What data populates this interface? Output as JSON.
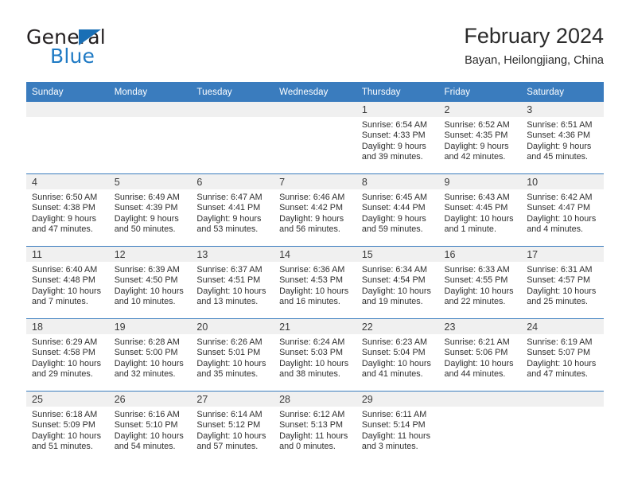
{
  "brand": {
    "name_part1": "General",
    "name_part2": "Blue",
    "triangle_color": "#1a6fb5",
    "blue_color": "#1f7ac4"
  },
  "header": {
    "month_title": "February 2024",
    "location": "Bayan, Heilongjiang, China",
    "header_bg": "#3a7cbe",
    "daynum_bg": "#f0f0f0"
  },
  "weekdays": [
    "Sunday",
    "Monday",
    "Tuesday",
    "Wednesday",
    "Thursday",
    "Friday",
    "Saturday"
  ],
  "weeks": [
    [
      {
        "day": "",
        "sunrise": "",
        "sunset": "",
        "daylight_line1": "",
        "daylight_line2": ""
      },
      {
        "day": "",
        "sunrise": "",
        "sunset": "",
        "daylight_line1": "",
        "daylight_line2": ""
      },
      {
        "day": "",
        "sunrise": "",
        "sunset": "",
        "daylight_line1": "",
        "daylight_line2": ""
      },
      {
        "day": "",
        "sunrise": "",
        "sunset": "",
        "daylight_line1": "",
        "daylight_line2": ""
      },
      {
        "day": "1",
        "sunrise": "Sunrise: 6:54 AM",
        "sunset": "Sunset: 4:33 PM",
        "daylight_line1": "Daylight: 9 hours",
        "daylight_line2": "and 39 minutes."
      },
      {
        "day": "2",
        "sunrise": "Sunrise: 6:52 AM",
        "sunset": "Sunset: 4:35 PM",
        "daylight_line1": "Daylight: 9 hours",
        "daylight_line2": "and 42 minutes."
      },
      {
        "day": "3",
        "sunrise": "Sunrise: 6:51 AM",
        "sunset": "Sunset: 4:36 PM",
        "daylight_line1": "Daylight: 9 hours",
        "daylight_line2": "and 45 minutes."
      }
    ],
    [
      {
        "day": "4",
        "sunrise": "Sunrise: 6:50 AM",
        "sunset": "Sunset: 4:38 PM",
        "daylight_line1": "Daylight: 9 hours",
        "daylight_line2": "and 47 minutes."
      },
      {
        "day": "5",
        "sunrise": "Sunrise: 6:49 AM",
        "sunset": "Sunset: 4:39 PM",
        "daylight_line1": "Daylight: 9 hours",
        "daylight_line2": "and 50 minutes."
      },
      {
        "day": "6",
        "sunrise": "Sunrise: 6:47 AM",
        "sunset": "Sunset: 4:41 PM",
        "daylight_line1": "Daylight: 9 hours",
        "daylight_line2": "and 53 minutes."
      },
      {
        "day": "7",
        "sunrise": "Sunrise: 6:46 AM",
        "sunset": "Sunset: 4:42 PM",
        "daylight_line1": "Daylight: 9 hours",
        "daylight_line2": "and 56 minutes."
      },
      {
        "day": "8",
        "sunrise": "Sunrise: 6:45 AM",
        "sunset": "Sunset: 4:44 PM",
        "daylight_line1": "Daylight: 9 hours",
        "daylight_line2": "and 59 minutes."
      },
      {
        "day": "9",
        "sunrise": "Sunrise: 6:43 AM",
        "sunset": "Sunset: 4:45 PM",
        "daylight_line1": "Daylight: 10 hours",
        "daylight_line2": "and 1 minute."
      },
      {
        "day": "10",
        "sunrise": "Sunrise: 6:42 AM",
        "sunset": "Sunset: 4:47 PM",
        "daylight_line1": "Daylight: 10 hours",
        "daylight_line2": "and 4 minutes."
      }
    ],
    [
      {
        "day": "11",
        "sunrise": "Sunrise: 6:40 AM",
        "sunset": "Sunset: 4:48 PM",
        "daylight_line1": "Daylight: 10 hours",
        "daylight_line2": "and 7 minutes."
      },
      {
        "day": "12",
        "sunrise": "Sunrise: 6:39 AM",
        "sunset": "Sunset: 4:50 PM",
        "daylight_line1": "Daylight: 10 hours",
        "daylight_line2": "and 10 minutes."
      },
      {
        "day": "13",
        "sunrise": "Sunrise: 6:37 AM",
        "sunset": "Sunset: 4:51 PM",
        "daylight_line1": "Daylight: 10 hours",
        "daylight_line2": "and 13 minutes."
      },
      {
        "day": "14",
        "sunrise": "Sunrise: 6:36 AM",
        "sunset": "Sunset: 4:53 PM",
        "daylight_line1": "Daylight: 10 hours",
        "daylight_line2": "and 16 minutes."
      },
      {
        "day": "15",
        "sunrise": "Sunrise: 6:34 AM",
        "sunset": "Sunset: 4:54 PM",
        "daylight_line1": "Daylight: 10 hours",
        "daylight_line2": "and 19 minutes."
      },
      {
        "day": "16",
        "sunrise": "Sunrise: 6:33 AM",
        "sunset": "Sunset: 4:55 PM",
        "daylight_line1": "Daylight: 10 hours",
        "daylight_line2": "and 22 minutes."
      },
      {
        "day": "17",
        "sunrise": "Sunrise: 6:31 AM",
        "sunset": "Sunset: 4:57 PM",
        "daylight_line1": "Daylight: 10 hours",
        "daylight_line2": "and 25 minutes."
      }
    ],
    [
      {
        "day": "18",
        "sunrise": "Sunrise: 6:29 AM",
        "sunset": "Sunset: 4:58 PM",
        "daylight_line1": "Daylight: 10 hours",
        "daylight_line2": "and 29 minutes."
      },
      {
        "day": "19",
        "sunrise": "Sunrise: 6:28 AM",
        "sunset": "Sunset: 5:00 PM",
        "daylight_line1": "Daylight: 10 hours",
        "daylight_line2": "and 32 minutes."
      },
      {
        "day": "20",
        "sunrise": "Sunrise: 6:26 AM",
        "sunset": "Sunset: 5:01 PM",
        "daylight_line1": "Daylight: 10 hours",
        "daylight_line2": "and 35 minutes."
      },
      {
        "day": "21",
        "sunrise": "Sunrise: 6:24 AM",
        "sunset": "Sunset: 5:03 PM",
        "daylight_line1": "Daylight: 10 hours",
        "daylight_line2": "and 38 minutes."
      },
      {
        "day": "22",
        "sunrise": "Sunrise: 6:23 AM",
        "sunset": "Sunset: 5:04 PM",
        "daylight_line1": "Daylight: 10 hours",
        "daylight_line2": "and 41 minutes."
      },
      {
        "day": "23",
        "sunrise": "Sunrise: 6:21 AM",
        "sunset": "Sunset: 5:06 PM",
        "daylight_line1": "Daylight: 10 hours",
        "daylight_line2": "and 44 minutes."
      },
      {
        "day": "24",
        "sunrise": "Sunrise: 6:19 AM",
        "sunset": "Sunset: 5:07 PM",
        "daylight_line1": "Daylight: 10 hours",
        "daylight_line2": "and 47 minutes."
      }
    ],
    [
      {
        "day": "25",
        "sunrise": "Sunrise: 6:18 AM",
        "sunset": "Sunset: 5:09 PM",
        "daylight_line1": "Daylight: 10 hours",
        "daylight_line2": "and 51 minutes."
      },
      {
        "day": "26",
        "sunrise": "Sunrise: 6:16 AM",
        "sunset": "Sunset: 5:10 PM",
        "daylight_line1": "Daylight: 10 hours",
        "daylight_line2": "and 54 minutes."
      },
      {
        "day": "27",
        "sunrise": "Sunrise: 6:14 AM",
        "sunset": "Sunset: 5:12 PM",
        "daylight_line1": "Daylight: 10 hours",
        "daylight_line2": "and 57 minutes."
      },
      {
        "day": "28",
        "sunrise": "Sunrise: 6:12 AM",
        "sunset": "Sunset: 5:13 PM",
        "daylight_line1": "Daylight: 11 hours",
        "daylight_line2": "and 0 minutes."
      },
      {
        "day": "29",
        "sunrise": "Sunrise: 6:11 AM",
        "sunset": "Sunset: 5:14 PM",
        "daylight_line1": "Daylight: 11 hours",
        "daylight_line2": "and 3 minutes."
      },
      {
        "day": "",
        "sunrise": "",
        "sunset": "",
        "daylight_line1": "",
        "daylight_line2": ""
      },
      {
        "day": "",
        "sunrise": "",
        "sunset": "",
        "daylight_line1": "",
        "daylight_line2": ""
      }
    ]
  ]
}
